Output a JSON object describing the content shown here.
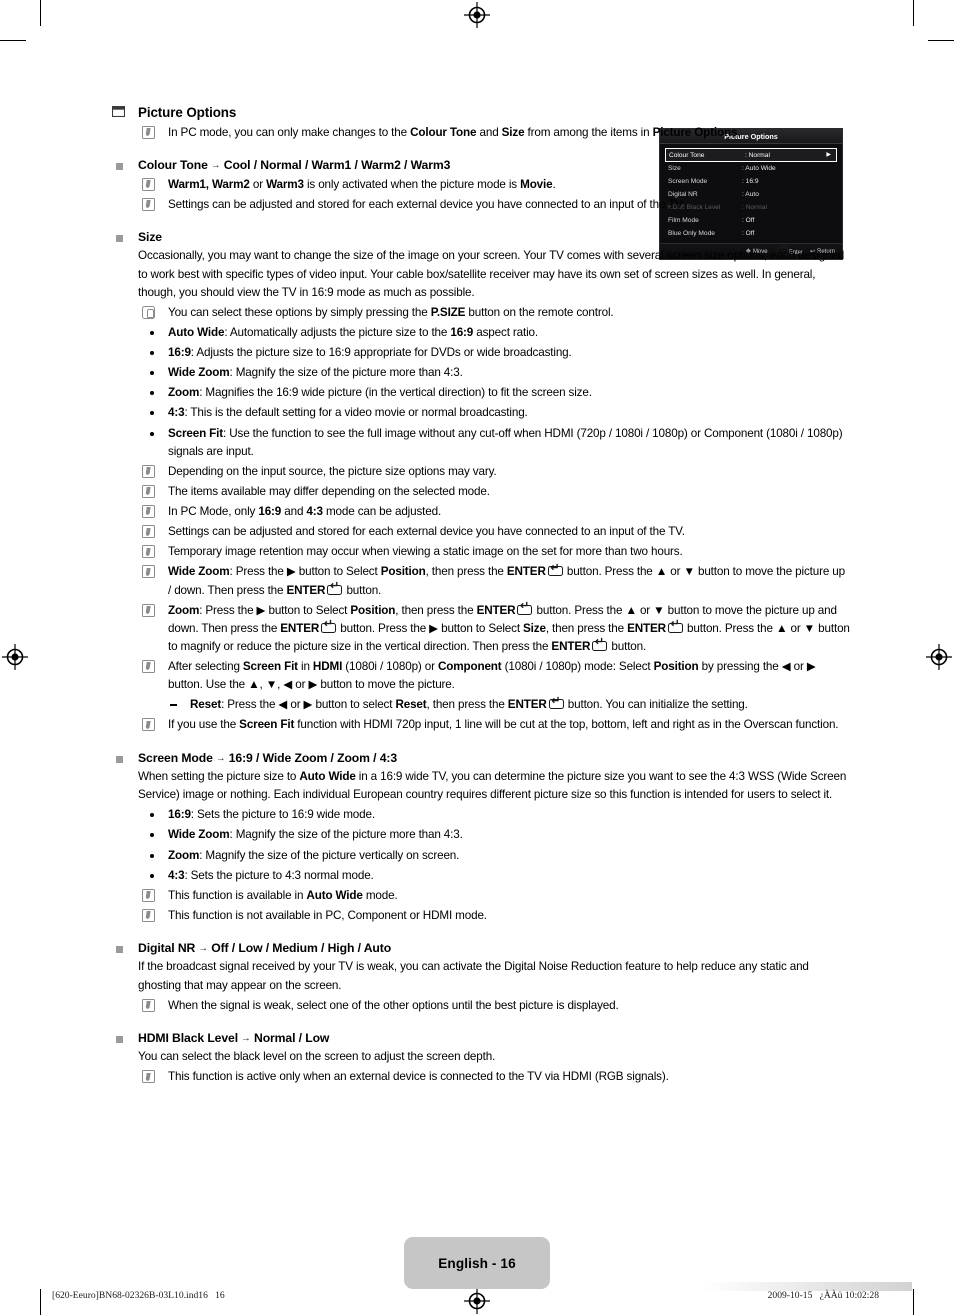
{
  "document": {
    "page_label": "English - 16",
    "footer_left": "[620-Eeuro]BN68-02326B-03L10.ind16   16",
    "footer_right": "2009-10-15   ¿ÀÀü 10:02:28"
  },
  "osd": {
    "title": "Picture Options",
    "rows": [
      {
        "label": "Colour Tone",
        "value": ": Normal",
        "selected": true,
        "dim": false,
        "caret": "▶"
      },
      {
        "label": "Size",
        "value": ": Auto Wide",
        "selected": false,
        "dim": false,
        "caret": ""
      },
      {
        "label": "Screen Mode",
        "value": ": 16:9",
        "selected": false,
        "dim": false,
        "caret": ""
      },
      {
        "label": "Digital NR",
        "value": ": Auto",
        "selected": false,
        "dim": false,
        "caret": ""
      },
      {
        "label": "HDMI Black Level",
        "value": ": Normal",
        "selected": false,
        "dim": true,
        "caret": ""
      },
      {
        "label": "Film Mode",
        "value": ": Off",
        "selected": false,
        "dim": false,
        "caret": ""
      },
      {
        "label": "Blue Only Mode",
        "value": ": Off",
        "selected": false,
        "dim": false,
        "caret": ""
      }
    ],
    "footer": {
      "move": "Move",
      "enter": "Enter",
      "return": "Return",
      "move_glyph": "✥",
      "return_glyph": "↩"
    }
  },
  "sections": {
    "picture_options": {
      "title": "Picture Options",
      "note1_html": "In PC mode, you can only make changes to the <b>Colour Tone</b> and <b>Size</b> from among the items in <b>Picture Options</b>."
    },
    "colour_tone": {
      "title_html": "Colour Tone <span class=\"arrow\">→</span> Cool / Normal / Warm1 / Warm2 / Warm3",
      "notes": [
        "<b>Warm1, Warm2</b> or <b>Warm3</b> is only activated when the picture mode is <b>Movie</b>.",
        "Settings can be adjusted and stored for each external device you have connected to an input of the TV."
      ]
    },
    "size": {
      "title": "Size",
      "para": "Occasionally, you may want to change the size of the image on your screen. Your TV comes with several screen size options, each designed to work best with specific types of video input. Your cable box/satellite receiver may have its own set of screen sizes as well. In general, though, you should view the TV in 16:9 mode as much as possible.",
      "remote_note_html": "You can select these options by simply pressing the <b>P.SIZE</b> button on the remote control.",
      "bullets": [
        "<b>Auto Wide</b>: Automatically adjusts the picture size to the <b>16:9</b> aspect ratio.",
        "<b>16:9</b>: Adjusts the picture size to 16:9 appropriate for DVDs or wide broadcasting.",
        "<b>Wide Zoom</b>: Magnify the size of the picture more than 4:3.",
        "<b>Zoom</b>: Magnifies the 16:9 wide picture (in the vertical direction) to fit the screen size.",
        "<b>4:3</b>: This is the default setting for a video movie or normal broadcasting.",
        "<b>Screen Fit</b>: Use the function to see the full image without any cut-off when HDMI (720p / 1080i / 1080p) or Component (1080i / 1080p) signals are input."
      ],
      "notes": [
        "Depending on the input source, the picture size options may vary.",
        "The items available may differ depending on the selected mode.",
        "In PC Mode, only <b>16:9</b> and <b>4:3</b> mode can be adjusted.",
        "Settings can be adjusted and stored for each external device you have connected to an input of the TV.",
        "Temporary image retention may occur when viewing a static image on the set for more than two hours.",
        "<b>Wide Zoom</b>: Press the ▶ button to Select <b>Position</b>, then press the <b>ENTER</b><span class=\"enterkey\"></span> button. Press the ▲ or ▼ button to move the picture up / down. Then press the <b>ENTER</b><span class=\"enterkey\"></span> button.",
        "<b>Zoom</b>: Press the ▶ button to Select <b>Position</b>, then press the <b>ENTER</b><span class=\"enterkey\"></span> button. Press the ▲ or ▼ button to move the picture up and down. Then press the <b>ENTER</b><span class=\"enterkey\"></span> button. Press the ▶ button to Select <b>Size</b>, then press the <b>ENTER</b><span class=\"enterkey\"></span> button. Press the ▲ or ▼ button to magnify or reduce the picture size in the vertical direction. Then press the <b>ENTER</b><span class=\"enterkey\"></span> button.",
        "After selecting <b>Screen Fit</b> in <b>HDMI</b> (1080i / 1080p) or <b>Component</b> (1080i / 1080p) mode: Select <b>Position</b> by pressing the ◀ or ▶ button. Use the ▲, ▼, ◀ or ▶ button to move the picture.",
        "If you use the <b>Screen Fit</b> function with HDMI 720p input, 1 line will be cut at the top, bottom, left and right as in the Overscan function."
      ],
      "reset_dash_html": "<b>Reset</b>: Press the ◀ or ▶ button to select <b>Reset</b>, then press the <b>ENTER</b><span class=\"enterkey\"></span> button. You can initialize the setting."
    },
    "screen_mode": {
      "title_html": "Screen Mode <span class=\"arrow\">→</span> 16:9 / Wide Zoom / Zoom / 4:3",
      "para_html": "When setting the picture size to <b>Auto Wide</b> in a 16:9 wide TV, you can determine the picture size you want to see the 4:3 WSS (Wide Screen Service) image or nothing. Each individual European country requires different picture size so this function is intended for users to select it.",
      "bullets": [
        "<b>16:9</b>: Sets the picture to 16:9 wide mode.",
        "<b>Wide Zoom</b>: Magnify the size of the picture more than 4:3.",
        "<b>Zoom</b>: Magnify the size of the picture vertically on screen.",
        "<b>4:3</b>: Sets the picture to 4:3 normal mode."
      ],
      "notes": [
        "This function is available in <b>Auto Wide</b> mode.",
        "This function is not available in PC, Component or HDMI mode."
      ]
    },
    "digital_nr": {
      "title_html": "Digital NR <span class=\"arrow\">→</span> Off / Low / Medium / High / Auto",
      "para": "If the broadcast signal received by your TV is weak, you can activate the Digital Noise Reduction feature to help reduce any static and ghosting that may appear on the screen.",
      "notes": [
        "When the signal is weak, select one of the other options until the best picture is displayed."
      ]
    },
    "hdmi_black_level": {
      "title_html": "HDMI Black Level <span class=\"arrow\">→</span> Normal / Low",
      "para": "You can select the black level on the screen to adjust the screen depth.",
      "notes": [
        "This function is active only when an external device is connected to the TV via HDMI (RGB signals)."
      ]
    }
  }
}
